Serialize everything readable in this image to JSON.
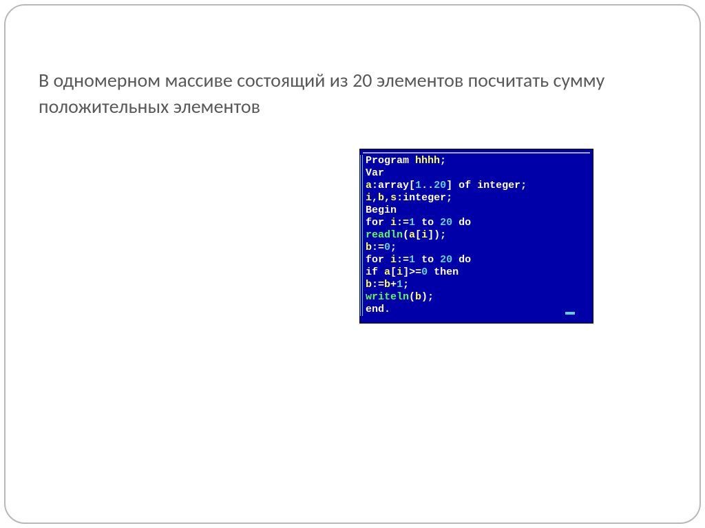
{
  "slide": {
    "title": "В одномерном массиве состоящий из 20 элементов посчитать сумму положительных элементов"
  },
  "code": {
    "tokens": [
      [
        {
          "c": "t-white",
          "t": "Program "
        },
        {
          "c": "t-yellow",
          "t": "hhhh"
        },
        {
          "c": "t-white",
          "t": ";"
        }
      ],
      [
        {
          "c": "t-white",
          "t": "Var"
        }
      ],
      [
        {
          "c": "t-yellow",
          "t": "a"
        },
        {
          "c": "t-white",
          "t": ":"
        },
        {
          "c": "t-white",
          "t": "array"
        },
        {
          "c": "t-white",
          "t": "["
        },
        {
          "c": "t-cyan",
          "t": "1"
        },
        {
          "c": "t-white",
          "t": ".."
        },
        {
          "c": "t-cyan",
          "t": "20"
        },
        {
          "c": "t-white",
          "t": "] "
        },
        {
          "c": "t-white",
          "t": "of "
        },
        {
          "c": "t-white",
          "t": "integer"
        },
        {
          "c": "t-white",
          "t": ";"
        }
      ],
      [
        {
          "c": "t-yellow",
          "t": "i"
        },
        {
          "c": "t-white",
          "t": ","
        },
        {
          "c": "t-yellow",
          "t": "b"
        },
        {
          "c": "t-white",
          "t": ","
        },
        {
          "c": "t-yellow",
          "t": "s"
        },
        {
          "c": "t-white",
          "t": ":"
        },
        {
          "c": "t-white",
          "t": "integer"
        },
        {
          "c": "t-white",
          "t": ";"
        }
      ],
      [
        {
          "c": "t-white",
          "t": "Begin"
        }
      ],
      [
        {
          "c": "t-white",
          "t": "for "
        },
        {
          "c": "t-yellow",
          "t": "i"
        },
        {
          "c": "t-white",
          "t": ":="
        },
        {
          "c": "t-cyan",
          "t": "1"
        },
        {
          "c": "t-white",
          "t": " to "
        },
        {
          "c": "t-cyan",
          "t": "20"
        },
        {
          "c": "t-white",
          "t": " do"
        }
      ],
      [
        {
          "c": "t-green",
          "t": "readln"
        },
        {
          "c": "t-white",
          "t": "("
        },
        {
          "c": "t-yellow",
          "t": "a"
        },
        {
          "c": "t-white",
          "t": "["
        },
        {
          "c": "t-yellow",
          "t": "i"
        },
        {
          "c": "t-white",
          "t": "]);"
        }
      ],
      [
        {
          "c": "t-yellow",
          "t": "b"
        },
        {
          "c": "t-white",
          "t": ":="
        },
        {
          "c": "t-cyan",
          "t": "0"
        },
        {
          "c": "t-white",
          "t": ";"
        }
      ],
      [
        {
          "c": "t-white",
          "t": "for "
        },
        {
          "c": "t-yellow",
          "t": "i"
        },
        {
          "c": "t-white",
          "t": ":="
        },
        {
          "c": "t-cyan",
          "t": "1"
        },
        {
          "c": "t-white",
          "t": " to "
        },
        {
          "c": "t-cyan",
          "t": "20"
        },
        {
          "c": "t-white",
          "t": " do"
        }
      ],
      [
        {
          "c": "t-white",
          "t": "if "
        },
        {
          "c": "t-yellow",
          "t": "a"
        },
        {
          "c": "t-white",
          "t": "["
        },
        {
          "c": "t-yellow",
          "t": "i"
        },
        {
          "c": "t-white",
          "t": "]>="
        },
        {
          "c": "t-cyan",
          "t": "0"
        },
        {
          "c": "t-white",
          "t": " then"
        }
      ],
      [
        {
          "c": "t-yellow",
          "t": "b"
        },
        {
          "c": "t-white",
          "t": ":="
        },
        {
          "c": "t-yellow",
          "t": "b"
        },
        {
          "c": "t-white",
          "t": "+"
        },
        {
          "c": "t-cyan",
          "t": "1"
        },
        {
          "c": "t-white",
          "t": ";"
        }
      ],
      [
        {
          "c": "t-green",
          "t": "writeln"
        },
        {
          "c": "t-white",
          "t": "("
        },
        {
          "c": "t-yellow",
          "t": "b"
        },
        {
          "c": "t-white",
          "t": ");"
        }
      ],
      [
        {
          "c": "t-white",
          "t": "end"
        },
        {
          "c": "t-white",
          "t": "."
        }
      ]
    ]
  }
}
